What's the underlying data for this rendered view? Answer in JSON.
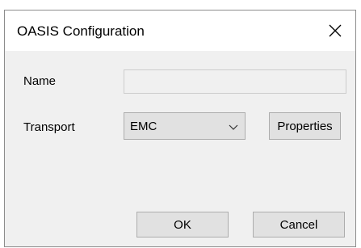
{
  "window": {
    "title": "OASIS Configuration",
    "close_icon": "close-icon"
  },
  "form": {
    "name_label": "Name",
    "name_value": "",
    "transport_label": "Transport",
    "transport_selected": "EMC",
    "transport_chevron_icon": "chevron-down-icon",
    "properties_label": "Properties"
  },
  "footer": {
    "ok_label": "OK",
    "cancel_label": "Cancel"
  },
  "colors": {
    "dialog_background": "#f0f0f0",
    "titlebar_background": "#ffffff",
    "button_face": "#e1e1e1",
    "button_border": "#adadad"
  }
}
